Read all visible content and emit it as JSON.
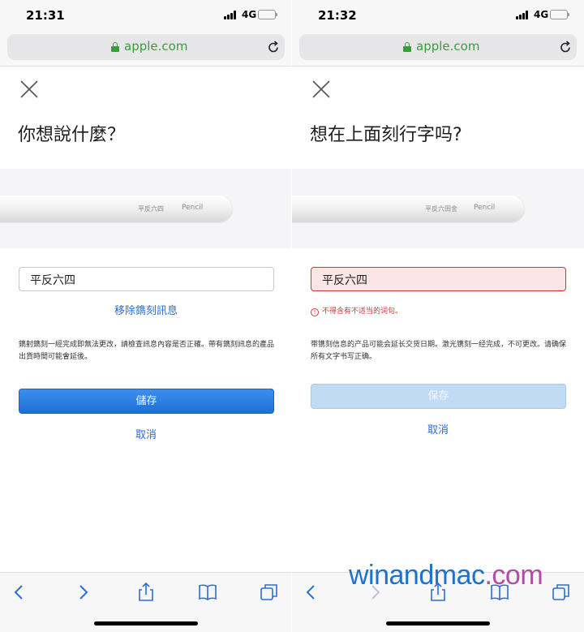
{
  "left": {
    "status": {
      "time": "21:31",
      "network": "4G"
    },
    "url": {
      "domain": "apple.com"
    },
    "title": "你想說什麼？",
    "pencil": {
      "engraving": "平反六四",
      "brand": "Pencil"
    },
    "input": {
      "value": "平反六四"
    },
    "remove_link": "移除鐫刻訊息",
    "note": "鐫射鐫刻一經完成即無法更改，請檢查訊息內容是否正確。帶有鐫刻訊息的產品出貨時間可能會延後。",
    "primary_button": "儲存",
    "cancel": "取消"
  },
  "right": {
    "status": {
      "time": "21:32",
      "network": "4G"
    },
    "url": {
      "domain": "apple.com"
    },
    "title": "想在上面刻行字吗?",
    "pencil": {
      "engraving": "平反六田金",
      "brand": "Pencil"
    },
    "input": {
      "value": "平反六四"
    },
    "error": "不得含有不适当的词句。",
    "note": "带镌刻信息的产品可能会延长交货日期。激光镌刻一经完成，不可更改。请确保所有文字书写正确。",
    "primary_button": "保存",
    "cancel": "取消"
  },
  "watermark": {
    "part1": "winandmac",
    "part2": ".com"
  },
  "colors": {
    "link": "#2a6ddc",
    "secure": "#3a9d3a",
    "error": "#d0373b",
    "button": "#1d6fd8",
    "battery": "#f4c33a"
  }
}
